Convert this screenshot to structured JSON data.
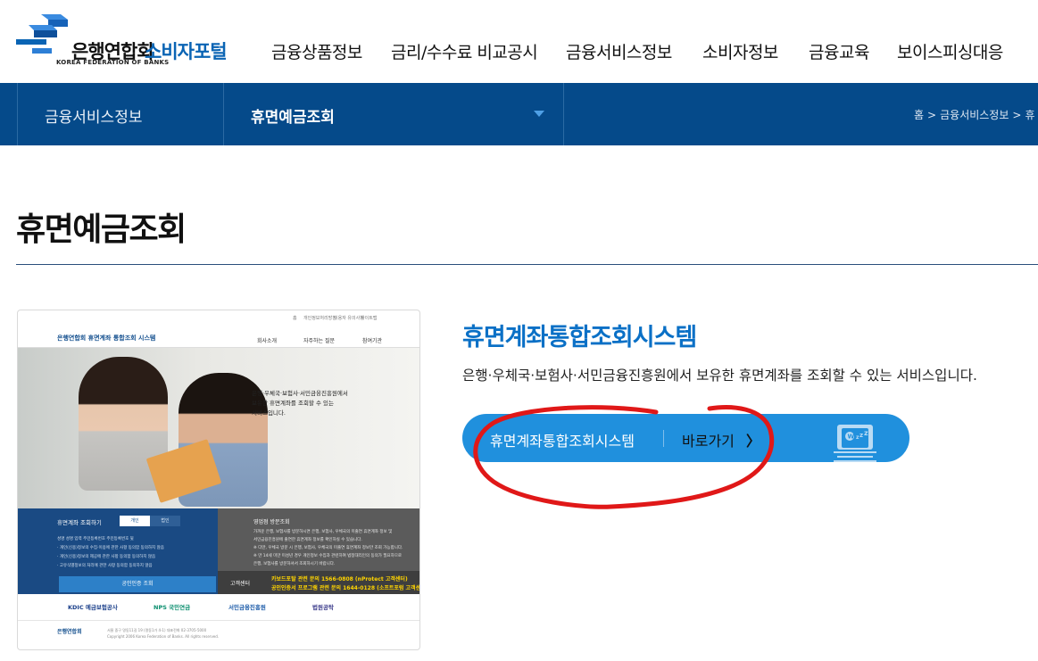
{
  "header": {
    "logo_ko": "은행연합회",
    "logo_en": "KOREA FEDERATION OF BANKS",
    "portal": "소비자포털",
    "nav": [
      "금융상품정보",
      "금리/수수료 비교공시",
      "금융서비스정보",
      "소비자정보",
      "금융교육",
      "보이스피싱대응"
    ]
  },
  "subnav": {
    "depth1": "금융서비스정보",
    "depth2": "휴면예금조회",
    "breadcrumb": [
      "홈",
      ">",
      "금융서비스정보",
      ">",
      "휴"
    ]
  },
  "page_title": "휴면예금조회",
  "thumbnail": {
    "top_links": [
      "홈",
      "개인정보처리방침",
      "이용자 유의사항",
      "사이트맵"
    ],
    "logo": "은행연합회  휴면계좌 통합조회 시스템",
    "menu": [
      "회사소개",
      "자주하는 질문",
      "참여기관"
    ],
    "photo_text": [
      "은행·우체국·보험사·서민금융진흥원에서",
      "보유한 휴면계좌를 조회할 수 있는",
      "서비스입니다."
    ],
    "left_title": "휴면계좌 조회하기",
    "tabs": [
      "개인",
      "법인"
    ],
    "left_lines": [
      "성명   성명 입력      주민등록번호        주민등록번호 뒷",
      "· 개인(신용)정보의 수집·이용에 관한 사항   동의함  동의하지 않음",
      "· 개인(신용)정보의 제공에 관한 사항   동의함  동의하지 않음",
      "· 고유식별정보의 처리에 관한 사항   동의함  동의하지 않음"
    ],
    "auth_button": "공인인증 조회",
    "right_title": "영업점 방문조회",
    "right_lines": [
      "가까운 은행, 보험사를 방문하시면 은행, 보험사, 우체국의 미출연 휴면계좌 정보 및",
      "서민금융진흥원에 출연한 휴면계좌 정보를 확인하실 수 있습니다.",
      "※ 다만, 우체국 방문 시 은행, 보험사, 우체국의 미출연 휴면계좌 정보만 조회 가능합니다.",
      "※ 만 14세 미만 미성년 경우 개인정보 수집과 관련하여 법정대리인의 동의가 필요하므로",
      "   은행, 보험사를 방문하셔서 조회하시기 바랍니다."
    ],
    "cs_label": "고객센터",
    "cs_numbers": [
      "카보드포탈 관련 문의 1566-0808 (nProtect 고객센터)",
      "공인인증서 프로그램 관련 문의 1644-0128 (소프트포럼 고객센터)"
    ],
    "partners": [
      "KDIC 예금보험공사",
      "NPS 국민연금",
      "서민금융진흥원",
      "법원공탁"
    ],
    "footer_logo": "은행연합회",
    "footer_text": [
      "서울 중구 명동11길 19 (명동1가 4-1)  대표전화 02-3705-5000",
      "Copyright 2006 Korea Federation of Banks. All rights reserved."
    ]
  },
  "system": {
    "title": "휴면계좌통합조회시스템",
    "description": "은행·우체국·보험사·서민금융진흥원에서 보유한 휴면계좌를 조회할 수 있는 서비스입니다.",
    "button_label": "휴면계좌통합조회시스템",
    "go_label": "바로가기",
    "chevron": "〉",
    "icon_text": "W zzz"
  },
  "colors": {
    "brand_blue": "#0a64b4",
    "subnav_bg": "#054a8a",
    "button_bg": "#2090dd",
    "annotation_red": "#e01818"
  }
}
